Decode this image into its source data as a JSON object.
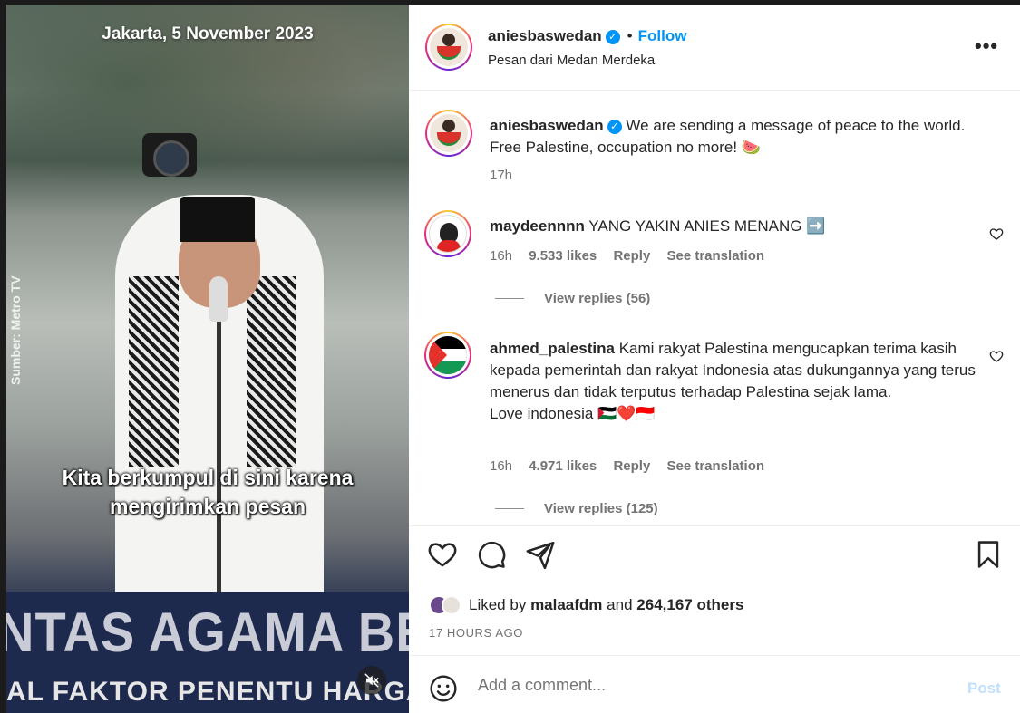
{
  "media": {
    "date_overlay": "Jakarta, 5 November 2023",
    "caption": "Kita berkumpul di sini karena mengirimkan pesan",
    "source": "Sumber: Metro TV",
    "banner_line1": "NTAS AGAMA BELA",
    "banner_line2": "AL FAKTOR PENENTU HARGA M",
    "mute_icon": "speaker-muted-icon"
  },
  "header": {
    "username": "aniesbaswedan",
    "follow_label": "Follow",
    "separator": "•",
    "location": "Pesan dari Medan Merdeka",
    "more_label": "•••"
  },
  "post": {
    "username": "aniesbaswedan",
    "caption": "We are sending a message of peace to the world. Free Palestine, occupation no more! 🍉",
    "time": "17h"
  },
  "comments": [
    {
      "username": "maydeennnn",
      "text": "YANG YAKIN ANIES MENANG ➡️",
      "time": "16h",
      "likes": "9.533 likes",
      "reply_label": "Reply",
      "translate_label": "See translation",
      "view_replies": "View replies (56)"
    },
    {
      "username": "ahmed_palestina",
      "text": "Kami rakyat Palestina mengucapkan terima kasih kepada pemerintah dan rakyat Indonesia atas dukungannya yang terus menerus dan tidak terputus terhadap Palestina sejak lama.",
      "text2": "Love indonesia 🇵🇸❤️🇮🇩",
      "time": "16h",
      "likes": "4.971 likes",
      "reply_label": "Reply",
      "translate_label": "See translation",
      "view_replies": "View replies (125)"
    }
  ],
  "likes": {
    "prefix": "Liked by",
    "user": "malaafdm",
    "and": "and",
    "others": "264,167 others"
  },
  "timestamp": "17 HOURS AGO",
  "add_comment": {
    "placeholder": "Add a comment...",
    "post_label": "Post"
  },
  "colors": {
    "accent": "#0095f6",
    "text": "#262626",
    "muted": "#737373",
    "post_disabled": "#c0dffd"
  }
}
